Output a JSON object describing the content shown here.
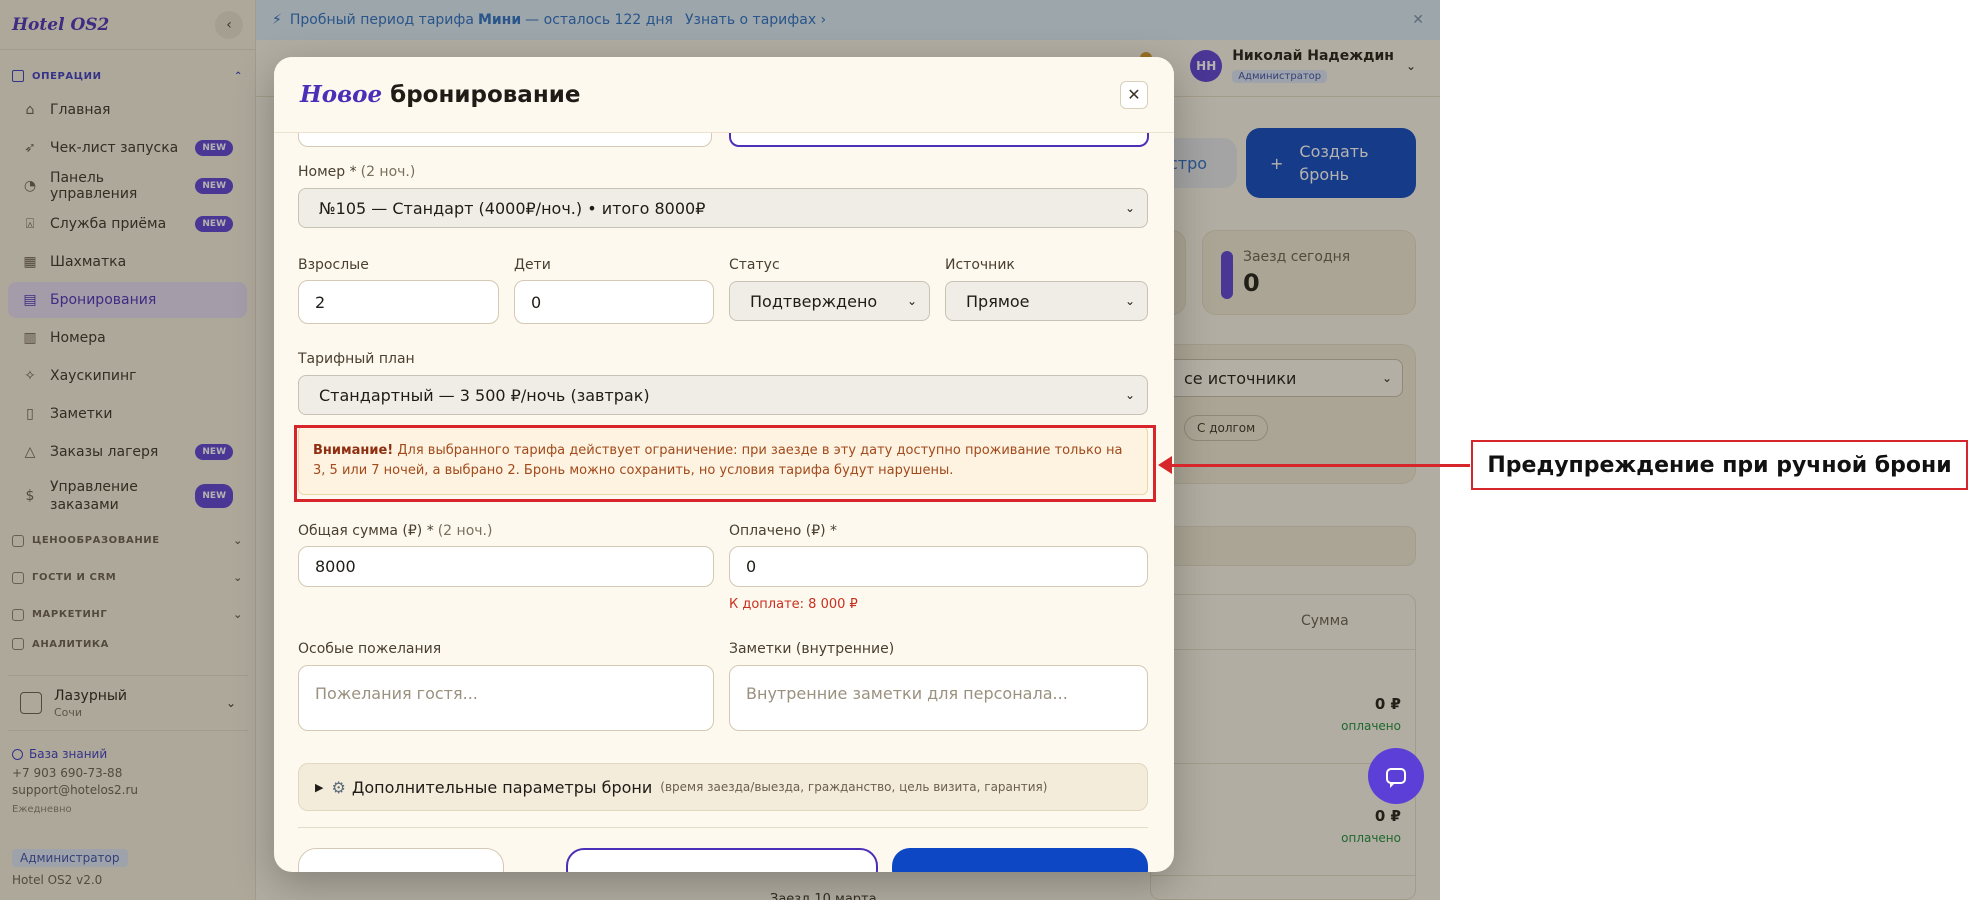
{
  "sidebar": {
    "logo": "Hotel OS2",
    "section_title": "ОПЕРАЦИИ",
    "items": [
      {
        "label": "Главная",
        "new": false
      },
      {
        "label": "Чек-лист запуска",
        "new": true
      },
      {
        "label": "Панель управления",
        "new": true
      },
      {
        "label": "Служба приёма",
        "new": true
      },
      {
        "label": "Шахматка",
        "new": false
      },
      {
        "label": "Бронирования",
        "new": false,
        "active": true
      },
      {
        "label": "Номера",
        "new": false
      },
      {
        "label": "Хаускипинг",
        "new": false
      },
      {
        "label": "Заметки",
        "new": false
      },
      {
        "label": "Заказы лагеря",
        "new": true
      },
      {
        "label": "Управление заказами",
        "new": true
      }
    ],
    "new_badge": "NEW",
    "groups": [
      "ЦЕНООБРАЗОВАНИЕ",
      "ГОСТИ И CRM",
      "МАРКЕТИНГ",
      "АНАЛИТИКА"
    ],
    "hotel": {
      "name": "Лазурный",
      "city": "Сочи"
    },
    "footer": {
      "kb_link": "База знаний",
      "phone": "+7 903 690-73-88",
      "email": "support@hotelos2.ru",
      "schedule": "Ежедневно"
    },
    "role": "Администратор",
    "version": "Hotel OS2 v2.0"
  },
  "banner": {
    "prefix": "Пробный период тарифа",
    "plan": "Мини",
    "suffix": "— осталось 122 дня",
    "link": "Узнать о тарифах ›"
  },
  "topbar": {
    "user_initials": "НН",
    "user_name": "Николай Надеждин",
    "user_role": "Администратор"
  },
  "page": {
    "quick_button": "стро",
    "create_button": "Создать бронь",
    "stat_label": "Заезд сегодня",
    "stat_value": "0",
    "source_select": "се источники",
    "debt_chip": "С долгом",
    "col_sum": "Сумма",
    "rows": [
      {
        "sum": "0 ₽",
        "paid": "оплачено"
      },
      {
        "sum": "0 ₽",
        "paid": "оплачено"
      }
    ],
    "bottom_note": "Заезд 10 марта"
  },
  "modal": {
    "title_accent": "Новое",
    "title_rest": "бронирование",
    "room_label": "Номер *",
    "room_hint": "(2 ноч.)",
    "room_value": "№105 — Стандарт (4000₽/ноч.) • итого 8000₽",
    "adults_label": "Взрослые",
    "adults_value": "2",
    "children_label": "Дети",
    "children_value": "0",
    "status_label": "Статус",
    "status_value": "Подтверждено",
    "source_label": "Источник",
    "source_value": "Прямое",
    "rate_label": "Тарифный план",
    "rate_value": "Стандартный — 3 500 ₽/ночь (завтрак)",
    "warning_title": "Внимание!",
    "warning_text": "Для выбранного тарифа действует ограничение: при заезде в эту дату доступно проживание только на 3, 5 или 7 ночей, а выбрано 2. Бронь можно сохранить, но условия тарифа будут нарушены.",
    "total_label": "Общая сумма (₽) *",
    "total_hint": "(2 ноч.)",
    "total_value": "8000",
    "paid_label": "Оплачено (₽) *",
    "paid_value": "0",
    "due_text": "К доплате: 8 000 ₽",
    "wishes_label": "Особые пожелания",
    "wishes_placeholder": "Пожелания гостя...",
    "notes_label": "Заметки (внутренние)",
    "notes_placeholder": "Внутренние заметки для персонала...",
    "advanced_title": "Дополнительные параметры брони",
    "advanced_hint": "(время заезда/выезда, гражданство, цель визита, гарантия)"
  },
  "annotation": {
    "label": "Предупреждение при ручной брони"
  },
  "colors": {
    "accent": "#4b2fb8",
    "primary_button": "#0d47c4",
    "warning_text": "#a24a1c",
    "annotation_red": "#d6262b",
    "due_red": "#c9301f",
    "paid_green": "#1d8a3a"
  }
}
